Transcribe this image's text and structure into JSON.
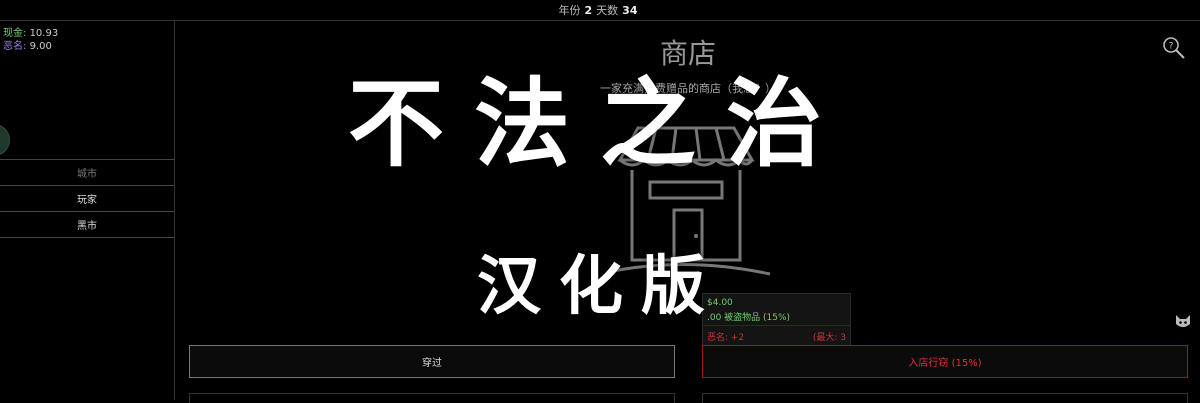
{
  "topbar": {
    "year_label": "年份",
    "year_value": "2",
    "days_label": "天数",
    "days_value": "34"
  },
  "stats": {
    "cash_label": "现金:",
    "cash_value": "10.93",
    "infamy_label": "恶名:",
    "infamy_value": "9.00"
  },
  "sidebar": {
    "items": [
      {
        "label": "城市",
        "active": false
      },
      {
        "label": "玩家",
        "active": true
      },
      {
        "label": "黑市",
        "active": true
      }
    ]
  },
  "shop": {
    "title": "商店",
    "subtitle": "一家充满免费赠品的商店（我想？）"
  },
  "tooltip": {
    "line1": "$4.00",
    "line2": ".00 被盗物品 (15%)",
    "line3": "恶名: +2",
    "line4": "(最大: 3"
  },
  "actions": {
    "pass_label": "穿过",
    "steal_label": "入店行窃 (15%)"
  },
  "overlay": {
    "title": "不法之治",
    "subtitle": "汉化版"
  },
  "colors": {
    "cash": "#6fcf6f",
    "infamy": "#9b7fe0",
    "danger": "#d33333"
  },
  "icons": [
    "search-icon",
    "shop-icon",
    "cat-icon"
  ]
}
